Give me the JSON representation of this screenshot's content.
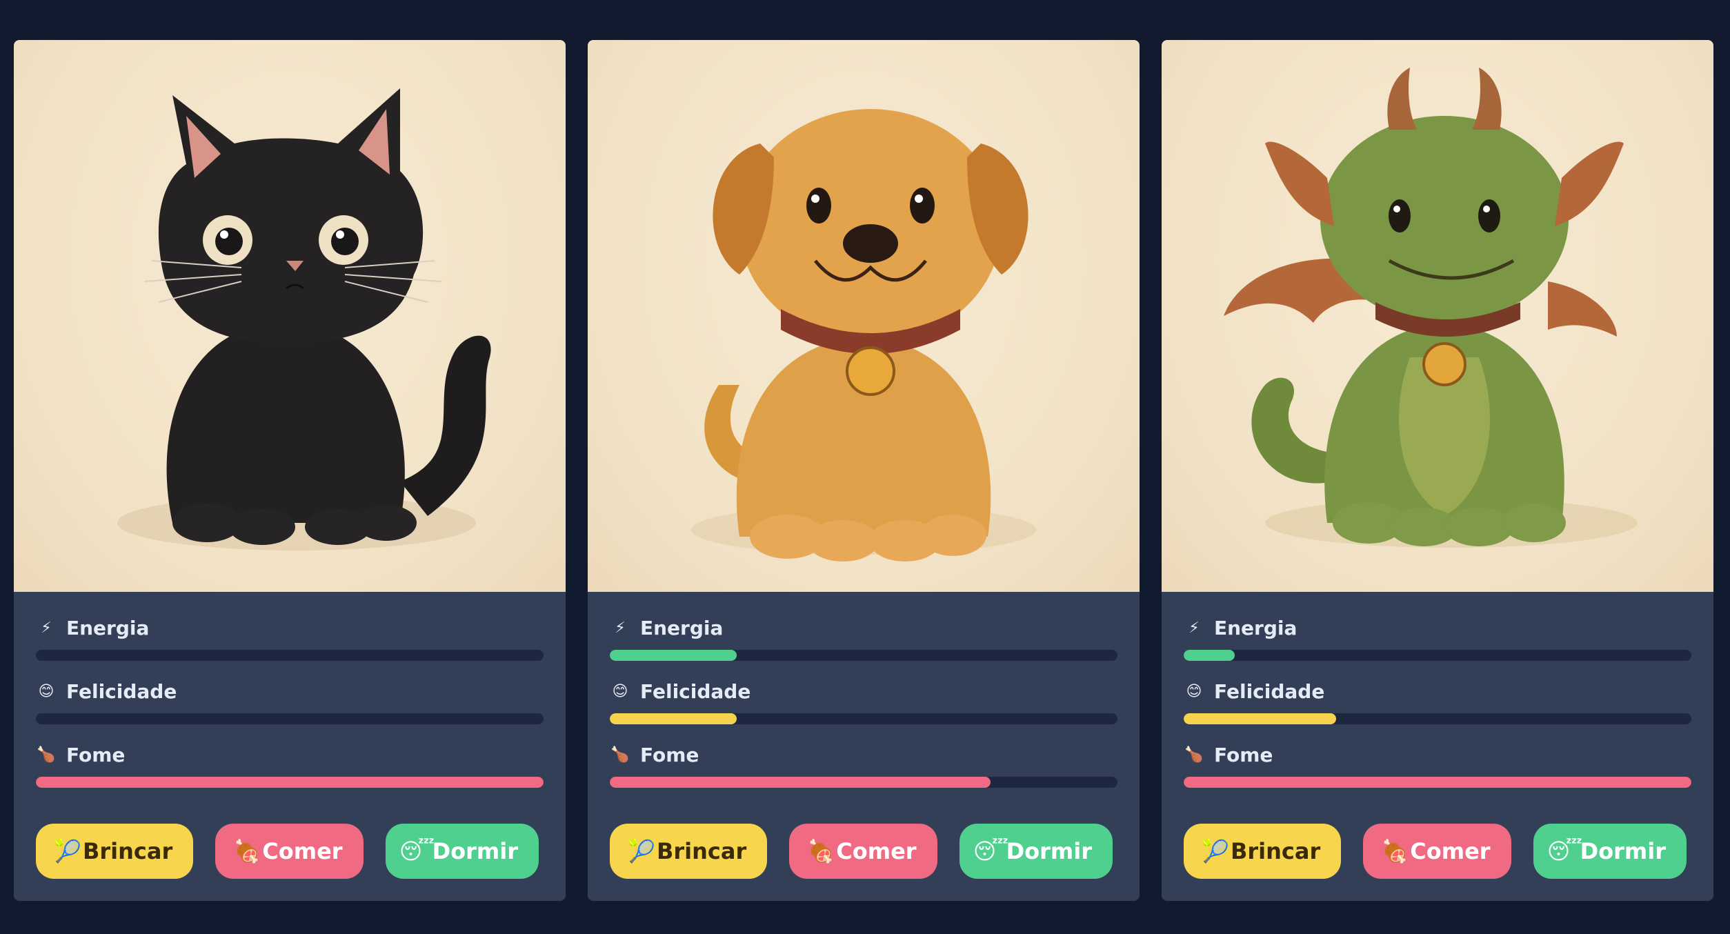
{
  "labels": {
    "energy": "Energia",
    "happiness": "Felicidade",
    "hunger": "Fome",
    "play": "Brincar",
    "eat": "Comer",
    "sleep": "Dormir"
  },
  "icons": {
    "energy": "lightning-icon",
    "happiness": "smiley-icon",
    "hunger": "drumstick-icon",
    "play": "tennis-ball-icon",
    "eat": "meat-icon",
    "sleep": "sleeping-face-icon"
  },
  "colors": {
    "energy": "#4fd08f",
    "happiness": "#f5d34f",
    "hunger": "#ef6a82",
    "background": "#111a2e",
    "card": "#323f57"
  },
  "pets": [
    {
      "kind": "cat",
      "energy": 0,
      "happiness": 0,
      "hunger": 100
    },
    {
      "kind": "dog",
      "energy": 25,
      "happiness": 25,
      "hunger": 75
    },
    {
      "kind": "dragon",
      "energy": 10,
      "happiness": 30,
      "hunger": 100
    }
  ]
}
